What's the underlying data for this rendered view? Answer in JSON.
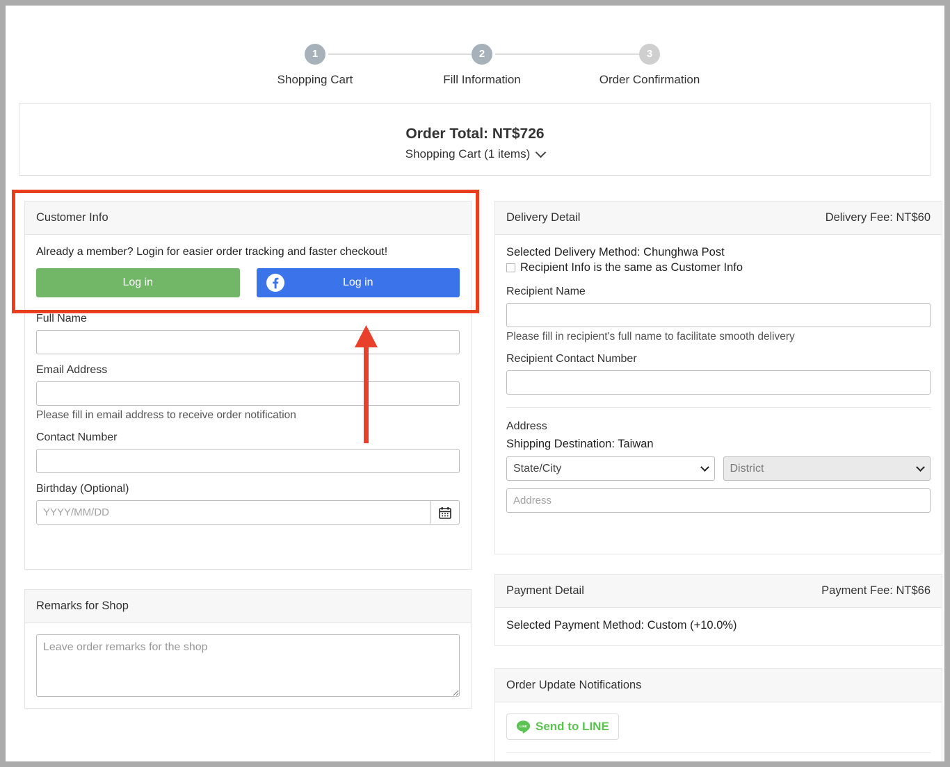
{
  "stepper": {
    "steps": [
      {
        "number": "1",
        "label": "Shopping Cart",
        "state": "active"
      },
      {
        "number": "2",
        "label": "Fill Information",
        "state": "active"
      },
      {
        "number": "3",
        "label": "Order Confirmation",
        "state": "inactive"
      }
    ]
  },
  "order_total": {
    "total_label": "Order Total: NT$726",
    "cart_summary": "Shopping Cart (1 items)"
  },
  "customer_info": {
    "title": "Customer Info",
    "member_prompt": "Already a member? Login for easier order tracking and faster checkout!",
    "login_button": "Log in",
    "facebook_login_button": "Log in",
    "full_name_label": "Full Name",
    "full_name_value": "",
    "email_label": "Email Address",
    "email_value": "",
    "email_hint": "Please fill in email address to receive order notification",
    "contact_label": "Contact Number",
    "contact_value": "",
    "birthday_label": "Birthday (Optional)",
    "birthday_placeholder": "YYYY/MM/DD",
    "birthday_value": ""
  },
  "remarks": {
    "title": "Remarks for Shop",
    "placeholder": "Leave order remarks for the shop",
    "value": ""
  },
  "delivery": {
    "title": "Delivery Detail",
    "fee": "Delivery Fee: NT$60",
    "selected_method": "Selected Delivery Method: Chunghwa Post",
    "same_as_customer_label": "Recipient Info is the same as Customer Info",
    "same_as_customer_checked": false,
    "recipient_name_label": "Recipient Name",
    "recipient_name_value": "",
    "recipient_name_hint": "Please fill in recipient's full name to facilitate smooth delivery",
    "recipient_contact_label": "Recipient Contact Number",
    "recipient_contact_value": "",
    "address_label": "Address",
    "shipping_destination": "Shipping Destination: Taiwan",
    "state_city_placeholder": "State/City",
    "district_placeholder": "District",
    "address_placeholder": "Address",
    "address_value": ""
  },
  "payment": {
    "title": "Payment Detail",
    "fee": "Payment Fee: NT$66",
    "selected_method": "Selected Payment Method: Custom (+10.0%)"
  },
  "notifications": {
    "title": "Order Update Notifications",
    "line_button": "Send to LINE"
  },
  "colors": {
    "green_button": "#72b768",
    "facebook_blue": "#3b73ea",
    "line_green": "#5bc451",
    "annotation_red": "#e8401f",
    "step_active": "#a6b1b9",
    "step_inactive": "#cfcfcf"
  }
}
